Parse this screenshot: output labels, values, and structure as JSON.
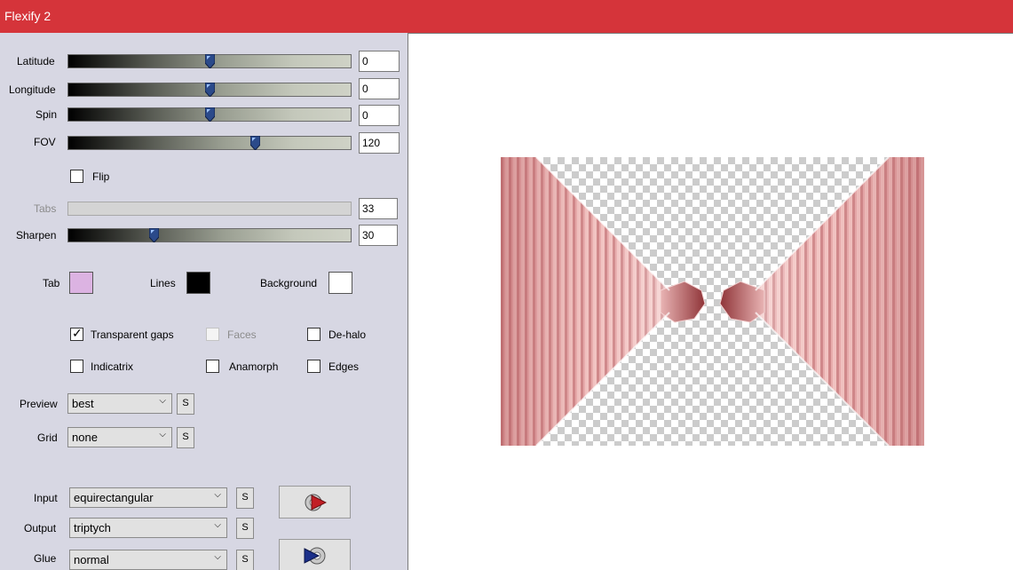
{
  "window": {
    "title": "Flexify 2"
  },
  "sliders": [
    {
      "label": "Latitude",
      "value": "0",
      "fraction": 0.5,
      "disabled": false
    },
    {
      "label": "Longitude",
      "value": "0",
      "fraction": 0.5,
      "disabled": false
    },
    {
      "label": "Spin",
      "value": "0",
      "fraction": 0.5,
      "disabled": false
    },
    {
      "label": "FOV",
      "value": "120",
      "fraction": 0.667,
      "disabled": false
    },
    {
      "label": "Tabs",
      "value": "33",
      "fraction": null,
      "disabled": true
    },
    {
      "label": "Sharpen",
      "value": "30",
      "fraction": 0.3,
      "disabled": false
    }
  ],
  "flip": {
    "label": "Flip",
    "checked": false
  },
  "colors": {
    "tab": {
      "label": "Tab",
      "color": "#dcb3e2"
    },
    "lines": {
      "label": "Lines",
      "color": "#000000"
    },
    "background": {
      "label": "Background",
      "color": "#ffffff"
    }
  },
  "options": {
    "transparent_gaps": {
      "label": "Transparent gaps",
      "checked": true
    },
    "faces": {
      "label": "Faces",
      "checked": false,
      "disabled": true
    },
    "de_halo": {
      "label": "De-halo",
      "checked": false
    },
    "indicatrix": {
      "label": "Indicatrix",
      "checked": false
    },
    "anamorph": {
      "label": "Anamorph",
      "checked": false
    },
    "edges": {
      "label": "Edges",
      "checked": false
    }
  },
  "dropdowns": {
    "preview": {
      "label": "Preview",
      "value": "best"
    },
    "grid": {
      "label": "Grid",
      "value": "none"
    },
    "input": {
      "label": "Input",
      "value": "equirectangular"
    },
    "output": {
      "label": "Output",
      "value": "triptych"
    },
    "glue": {
      "label": "Glue",
      "value": "normal"
    }
  },
  "small_button_label": "S",
  "icons": {
    "play_forward": "play-forward-icon",
    "play_back": "play-back-icon",
    "checkmark": "✓",
    "dropdown_arrow": "⌵"
  },
  "theme": {
    "titlebar_color": "#d5343a",
    "panel_color": "#d7d7e3",
    "preview_bg": "#ffffff",
    "tunnel_pink": "#e8a7a6",
    "tunnel_dark": "#9b3b3f"
  }
}
